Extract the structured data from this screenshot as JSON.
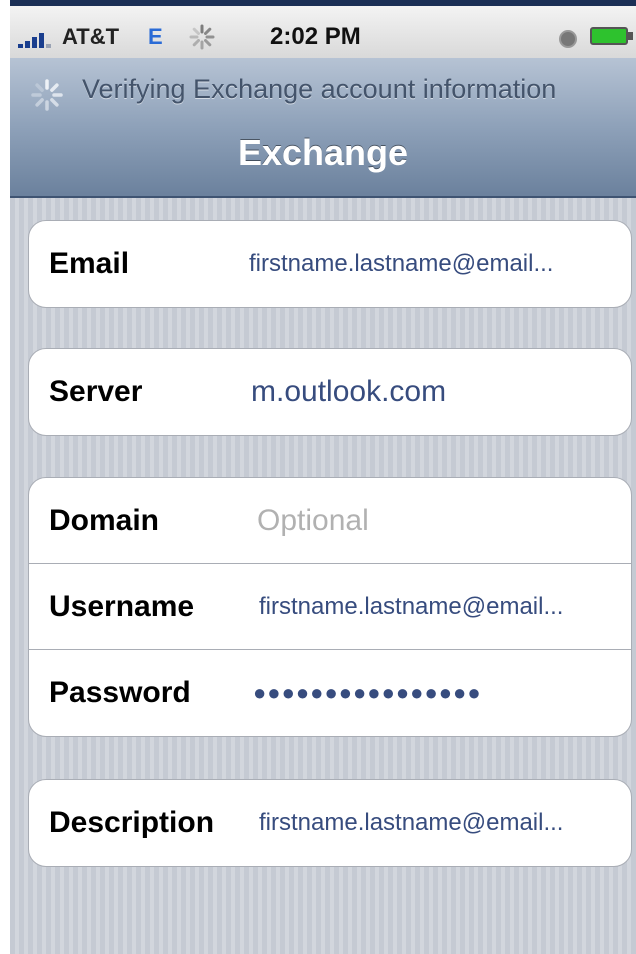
{
  "status_bar": {
    "carrier": "AT&T",
    "network": "E",
    "time": "2:02 PM",
    "alarm_icon": "alarm-clock-icon",
    "battery_icon": "battery-full-icon",
    "activity_icon": "activity-spinner-icon"
  },
  "nav": {
    "prompt": "Verifying Exchange account information",
    "title": "Exchange"
  },
  "form": {
    "email": {
      "label": "Email",
      "value": "firstname.lastname@email..."
    },
    "server": {
      "label": "Server",
      "value": "m.outlook.com"
    },
    "domain": {
      "label": "Domain",
      "placeholder": "Optional"
    },
    "username": {
      "label": "Username",
      "value": "firstname.lastname@email..."
    },
    "password": {
      "label": "Password",
      "value": "●●●●●●●●●●●●●●●●"
    },
    "description": {
      "label": "Description",
      "value": "firstname.lastname@email..."
    }
  },
  "colors": {
    "navbar_top": "#b6c3d4",
    "navbar_bottom": "#6b819d",
    "value_text": "#374c7e",
    "placeholder_text": "#b1b1b1"
  }
}
